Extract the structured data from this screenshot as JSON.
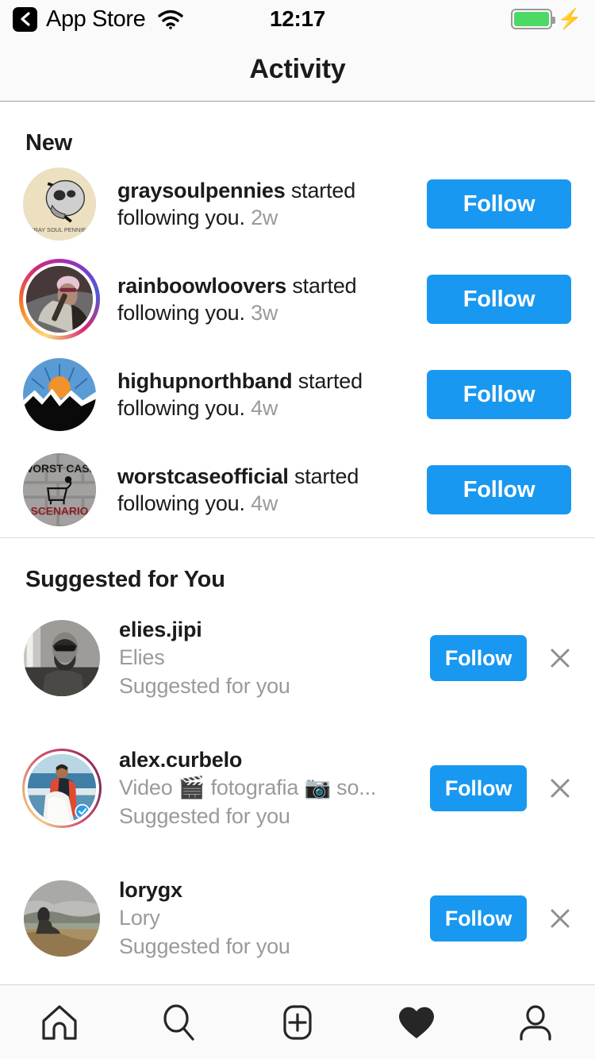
{
  "status_bar": {
    "back_label": "App Store",
    "time": "12:17",
    "wifi_icon": "wifi-icon",
    "battery_icon": "battery-icon",
    "charging_icon": "lightning-bolt-icon",
    "battery_color": "#4cd964"
  },
  "header": {
    "title": "Activity"
  },
  "theme": {
    "follow_blue": "#1898f0",
    "muted_gray": "#9a9a9a",
    "text_dark": "#1b1b1b",
    "bg": "#ffffff",
    "chrome_bg": "#fafafa"
  },
  "new_section": {
    "title": "New",
    "items": [
      {
        "username": "graysoulpennies",
        "action": " started following you. ",
        "time": "2w",
        "button": "Follow",
        "avatar": "graysoulpennies-avatar",
        "has_story_ring": false
      },
      {
        "username": "rainboowloovers",
        "action": " started following you. ",
        "time": "3w",
        "button": "Follow",
        "avatar": "rainboowloovers-avatar",
        "has_story_ring": true
      },
      {
        "username": "highupnorthband",
        "action": " started following you. ",
        "time": "4w",
        "button": "Follow",
        "avatar": "highupnorthband-avatar",
        "has_story_ring": false
      },
      {
        "username": "worstcaseofficial",
        "action": " started following you. ",
        "time": "4w",
        "button": "Follow",
        "avatar": "worstcaseofficial-avatar",
        "has_story_ring": false
      }
    ]
  },
  "suggested_section": {
    "title": "Suggested for You",
    "items": [
      {
        "username": "elies.jipi",
        "subtitle": "Elies",
        "meta": "Suggested for you",
        "button": "Follow",
        "dismiss": "×",
        "avatar": "elies-jipi-avatar",
        "has_story_ring": false,
        "verified": false
      },
      {
        "username": "alex.curbelo",
        "subtitle": "Video 🎬 fotografia 📷 so...",
        "meta": "Suggested for you",
        "button": "Follow",
        "dismiss": "×",
        "avatar": "alex-curbelo-avatar",
        "has_story_ring": true,
        "verified": true
      },
      {
        "username": "lorygx",
        "subtitle": "Lory",
        "meta": "Suggested for you",
        "button": "Follow",
        "dismiss": "×",
        "avatar": "lorygx-avatar",
        "has_story_ring": false,
        "verified": false
      }
    ]
  },
  "tab_bar": {
    "tabs": [
      {
        "name": "home-icon",
        "active": false
      },
      {
        "name": "search-icon",
        "active": false
      },
      {
        "name": "add-post-icon",
        "active": false
      },
      {
        "name": "activity-heart-icon",
        "active": true
      },
      {
        "name": "profile-icon",
        "active": false
      }
    ]
  }
}
